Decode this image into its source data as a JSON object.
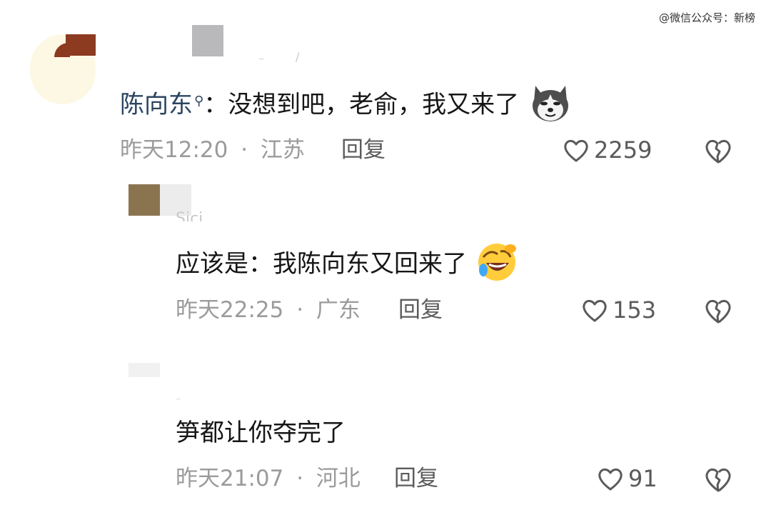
{
  "watermark": "@微信公众号：新榜",
  "comments": [
    {
      "author": "陈向东",
      "separator": "：",
      "text": "没想到吧，老俞，我又来了",
      "emoji": "husky-dog-emoji",
      "time": "昨天12:20",
      "dot": "·",
      "location": "江苏",
      "reply_label": "回复",
      "likes": "2259"
    },
    {
      "username_partial": "Sici",
      "text": "应该是：我陈向东又回来了",
      "emoji": "rolling-laughing-emoji",
      "time": "昨天22:25",
      "dot": "·",
      "location": "广东",
      "reply_label": "回复",
      "likes": "153"
    },
    {
      "text": "笋都让你夺完了",
      "time": "昨天21:07",
      "dot": "·",
      "location": "河北",
      "reply_label": "回复",
      "likes": "91"
    }
  ],
  "icons": {
    "like": "heart-outline-icon",
    "dislike": "broken-heart-icon",
    "author_badge": "search-icon"
  }
}
